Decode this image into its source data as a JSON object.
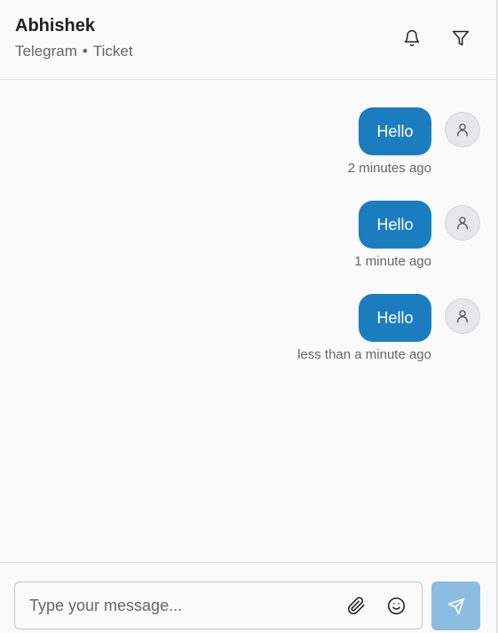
{
  "header": {
    "contact_name": "Abhishek",
    "channel": "Telegram",
    "separator": "•",
    "type": "Ticket",
    "icons": [
      "bell-icon",
      "filter-icon"
    ]
  },
  "messages": [
    {
      "text": "Hello",
      "time": "2 minutes ago",
      "avatar_icon": "user-icon"
    },
    {
      "text": "Hello",
      "time": "1 minute ago",
      "avatar_icon": "user-icon"
    },
    {
      "text": "Hello",
      "time": "less than a minute ago",
      "avatar_icon": "user-icon"
    }
  ],
  "composer": {
    "placeholder": "Type your message...",
    "value": "",
    "icons": [
      "paperclip-icon",
      "smile-icon",
      "send-icon"
    ]
  },
  "colors": {
    "bubble": "#1b7dc0",
    "send_button": "#8dbde0",
    "background": "#fafafa"
  }
}
